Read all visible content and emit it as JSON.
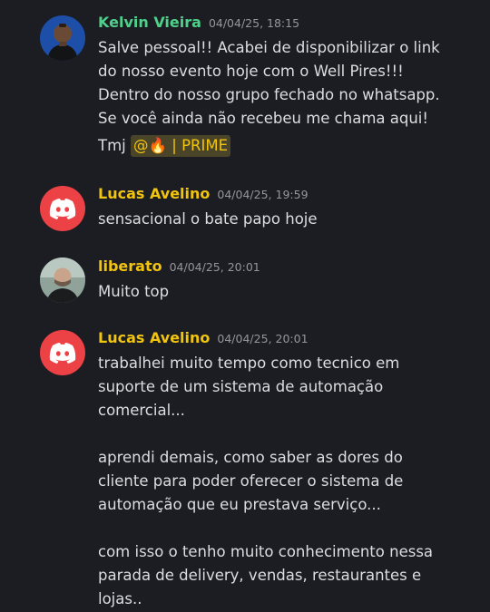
{
  "colors": {
    "background": "#1c1d22",
    "author_kelvin": "#4fd18b",
    "author_yellow": "#f1c40f",
    "discord_red": "#ed4245",
    "mention_bg": "#4a4429",
    "timestamp": "#94969c",
    "text": "#dcdde1"
  },
  "messages": [
    {
      "author": "Kelvin Vieira",
      "timestamp": "04/04/25, 18:15",
      "avatar": "user-photo-avatar",
      "lines": [
        "Salve pessoal!! Acabei de disponibilizar o link",
        "do nosso evento hoje com o Well Pires!!!",
        "Dentro do nosso grupo fechado no whatsapp.",
        "Se você ainda não recebeu me chama aqui!"
      ],
      "last_line_prefix": "Tmj ",
      "mention": "@🔥 | PRIME"
    },
    {
      "author": "Lucas Avelino",
      "timestamp": "04/04/25, 19:59",
      "avatar": "discord-default-avatar",
      "lines": [
        "sensacional o bate papo hoje"
      ]
    },
    {
      "author": "liberato",
      "timestamp": "04/04/25, 20:01",
      "avatar": "user-photo-avatar",
      "lines": [
        "Muito top"
      ]
    },
    {
      "author": "Lucas Avelino",
      "timestamp": "04/04/25, 20:01",
      "avatar": "discord-default-avatar",
      "paragraphs": [
        [
          "trabalhei muito tempo como tecnico em",
          "suporte de um sistema de automação",
          "comercial..."
        ],
        [
          "aprendi demais, como saber as dores do",
          "cliente para poder oferecer o sistema de",
          "automação que eu prestava serviço..."
        ],
        [
          "com isso  o tenho muito conhecimento nessa",
          "parada de delivery, vendas, restaurantes e",
          "lojas.."
        ]
      ]
    }
  ]
}
